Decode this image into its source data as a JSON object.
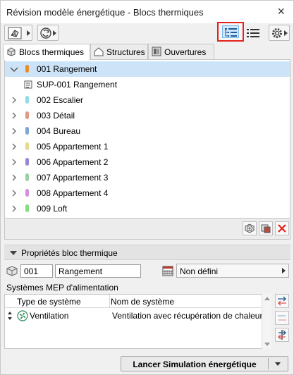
{
  "window": {
    "title": "Révision modèle énergétique - Blocs thermiques",
    "close_glyph": "×"
  },
  "toolbar": {
    "model_view_icon": "3d-model-icon",
    "refresh_icon": "refresh-icon",
    "tree_view_icon": "tree-list-icon",
    "flat_list_icon": "list-icon",
    "settings_icon": "gear-icon",
    "highlight_color": "#e2231a"
  },
  "tabs": [
    {
      "label": "Blocs thermiques",
      "icon": "thermal-block-icon",
      "active": true
    },
    {
      "label": "Structures",
      "icon": "structure-icon",
      "active": false
    },
    {
      "label": "Ouvertures",
      "icon": "opening-icon",
      "active": false
    }
  ],
  "tree": {
    "rows": [
      {
        "label": "001 Rangement",
        "color": "#e88a2e",
        "expanded": true,
        "selected": true
      },
      {
        "label": "SUP-001 Rangement",
        "child": true,
        "icon": "surface-icon"
      },
      {
        "label": "002 Escalier",
        "color": "#8fdbe6"
      },
      {
        "label": "003 Détail",
        "color": "#e39a83"
      },
      {
        "label": "004 Bureau",
        "color": "#7ea7d8"
      },
      {
        "label": "005 Appartement 1",
        "color": "#e6d98a"
      },
      {
        "label": "006 Appartement 2",
        "color": "#9a86d8"
      },
      {
        "label": "007 Appartement 3",
        "color": "#99d2a0"
      },
      {
        "label": "008 Appartement 4",
        "color": "#d58fdc"
      },
      {
        "label": "009 Loft",
        "color": "#86dc82"
      }
    ]
  },
  "tree_actions": {
    "add_icon": "add-block-icon",
    "assign_icon": "assign-block-icon",
    "delete_icon": "delete-x-icon"
  },
  "properties": {
    "title": "Propriétés bloc thermique",
    "id_value": "001",
    "name_value": "Rangement",
    "operation_profile": "Non défini"
  },
  "systems": {
    "label": "Systèmes MEP d'alimentation",
    "columns": [
      "Type de système",
      "Nom de système"
    ],
    "rows": [
      {
        "type": "Ventilation",
        "name": "Ventilation avec récupération de chaleur",
        "icon": "fan-icon"
      }
    ]
  },
  "footer": {
    "simulate_label": "Lancer Simulation énergétique"
  }
}
